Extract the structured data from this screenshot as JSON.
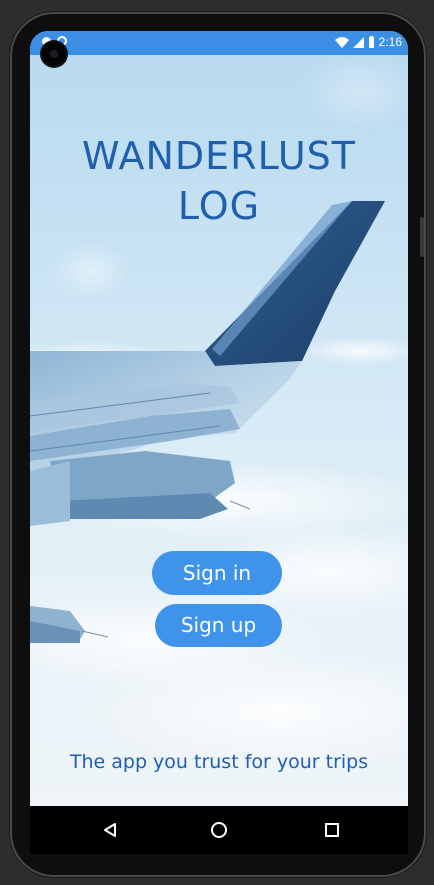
{
  "status_bar": {
    "time": "2:16",
    "icons": [
      "notification-icon",
      "sync-icon",
      "wifi-icon",
      "signal-icon",
      "battery-icon"
    ],
    "background": "#3d8fe6"
  },
  "app": {
    "title_line1": "WANDERLUST",
    "title_line2": "LOG",
    "tagline": "The app you trust for your trips",
    "title_color": "#1f5fb0"
  },
  "buttons": {
    "sign_in": "Sign in",
    "sign_up": "Sign up",
    "color": "#3f93e8"
  },
  "nav_bar": {
    "icons": [
      "back-icon",
      "home-icon",
      "recent-apps-icon"
    ]
  }
}
